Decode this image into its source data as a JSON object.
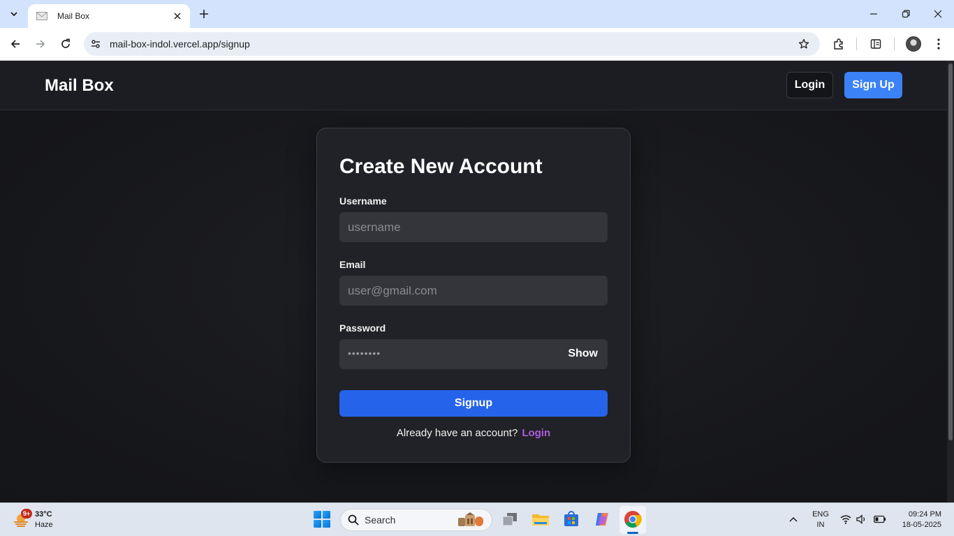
{
  "browser": {
    "tab_title": "Mail Box",
    "url": "mail-box-indol.vercel.app/signup"
  },
  "navbar": {
    "brand": "Mail Box",
    "login_label": "Login",
    "signup_label": "Sign Up"
  },
  "form": {
    "title": "Create New Account",
    "username_label": "Username",
    "username_placeholder": "username",
    "email_label": "Email",
    "email_placeholder": "user@gmail.com",
    "password_label": "Password",
    "password_masked": "••••••••",
    "show_label": "Show",
    "submit_label": "Signup",
    "footer_text": "Already have an account?",
    "footer_link": "Login"
  },
  "taskbar": {
    "weather_badge": "9+",
    "weather_temp": "33°C",
    "weather_condition": "Haze",
    "search_label": "Search",
    "lang_line1": "ENG",
    "lang_line2": "IN",
    "time": "09:24 PM",
    "date": "18-05-2025"
  },
  "colors": {
    "primary_blue": "#2563eb",
    "nav_signup_blue": "#3b82f6",
    "link_purple": "#b05ddc",
    "card_bg": "#212227",
    "input_bg": "#34353b"
  },
  "icons": [
    "tab-search-icon",
    "mail-favicon",
    "close-icon",
    "plus-icon",
    "minimize-icon",
    "restore-icon",
    "back-icon",
    "forward-icon",
    "reload-icon",
    "site-info-icon",
    "star-icon",
    "extensions-icon",
    "sidebar-icon",
    "profile-avatar",
    "menu-icon",
    "weather-icon",
    "windows-start-icon",
    "search-icon",
    "task-view-icon",
    "file-explorer-icon",
    "store-icon",
    "copilot-icon",
    "chrome-icon",
    "chevron-up-icon",
    "wifi-icon",
    "volume-icon",
    "battery-icon"
  ]
}
